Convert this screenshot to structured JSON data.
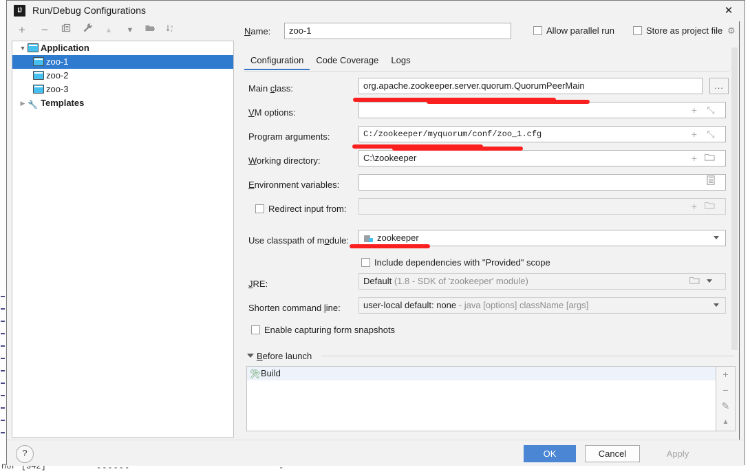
{
  "window": {
    "title": "Run/Debug Configurations",
    "app_icon": "intellij-idea-icon",
    "close_icon": "✕"
  },
  "toolbar": {
    "icons": [
      {
        "name": "add-configuration-icon",
        "glyph": "+"
      },
      {
        "name": "remove-configuration-icon",
        "glyph": "−"
      },
      {
        "name": "copy-configuration-icon",
        "glyph": "❐"
      },
      {
        "name": "edit-templates-icon",
        "glyph": "🔧"
      },
      {
        "name": "move-up-icon",
        "glyph": "▲"
      },
      {
        "name": "move-down-icon",
        "glyph": "▼"
      },
      {
        "name": "move-into-folder-icon",
        "glyph": "❐"
      },
      {
        "name": "sort-alphabetically-icon",
        "glyph": "↓"
      }
    ]
  },
  "tree": {
    "group_label": "Application",
    "items": [
      {
        "label": "zoo-1",
        "selected": true
      },
      {
        "label": "zoo-2",
        "selected": false
      },
      {
        "label": "zoo-3",
        "selected": false
      }
    ],
    "templates_label": "Templates"
  },
  "name_row": {
    "label": "Name:",
    "value": "zoo-1",
    "allow_parallel_run": "Allow parallel run",
    "allow_parallel_run_checked": false,
    "store_as_project_file": "Store as project file",
    "store_as_project_file_checked": false,
    "gear_icon": "⚙"
  },
  "tabs": [
    {
      "label": "Configuration",
      "active": true
    },
    {
      "label": "Code Coverage",
      "active": false
    },
    {
      "label": "Logs",
      "active": false
    }
  ],
  "form": {
    "main_class": {
      "label": "Main class:",
      "value": "org.apache.zookeeper.server.quorum.QuorumPeerMain",
      "browse_label": "..."
    },
    "vm_options": {
      "label": "VM options:",
      "value": "",
      "macro_icon": "+",
      "expand_icon": "⤡"
    },
    "program_arguments": {
      "label": "Program arguments:",
      "value": "C:/zookeeper/myquorum/conf/zoo_1.cfg",
      "macro_icon": "+",
      "expand_icon": "⤡"
    },
    "working_directory": {
      "label": "Working directory:",
      "value": "C:\\zookeeper",
      "macro_icon": "+",
      "folder_icon": "📁"
    },
    "environment_variables": {
      "label": "Environment variables:",
      "value": "",
      "list_icon": "≡"
    },
    "redirect_input": {
      "label": "Redirect input from:",
      "checked": false,
      "value": "",
      "macro_icon": "+",
      "folder_icon": "📁"
    },
    "classpath_module": {
      "label": "Use classpath of module:",
      "value": "zookeeper",
      "module_icon": "module-icon"
    },
    "include_provided": {
      "label": "Include dependencies with \"Provided\" scope",
      "checked": false
    },
    "jre": {
      "label": "JRE:",
      "value": "Default",
      "hint": "(1.8 - SDK of 'zookeeper' module)",
      "folder_icon": "📁"
    },
    "shorten_command_line": {
      "label": "Shorten command line:",
      "value": "user-local default: none",
      "hint": "- java [options] className [args]"
    },
    "form_snapshots": {
      "label": "Enable capturing form snapshots",
      "checked": false
    }
  },
  "before_launch": {
    "title": "Before launch",
    "items": [
      {
        "label": "Build",
        "icon": "build-hammer-icon"
      }
    ],
    "side_buttons": [
      {
        "name": "add-task-icon",
        "glyph": "+"
      },
      {
        "name": "remove-task-icon",
        "glyph": "−"
      },
      {
        "name": "edit-task-icon",
        "glyph": "✎"
      },
      {
        "name": "move-task-up-icon",
        "glyph": "▲"
      }
    ]
  },
  "footer": {
    "help_label": "?",
    "ok_label": "OK",
    "cancel_label": "Cancel",
    "apply_label": "Apply"
  },
  "annotations": {
    "color": "#fb2020",
    "marks": [
      {
        "target": "main-class-underline"
      },
      {
        "target": "program-arguments-underline"
      },
      {
        "target": "classpath-module-underline"
      }
    ]
  },
  "background": {
    "fragment_text": "nor [342]"
  }
}
